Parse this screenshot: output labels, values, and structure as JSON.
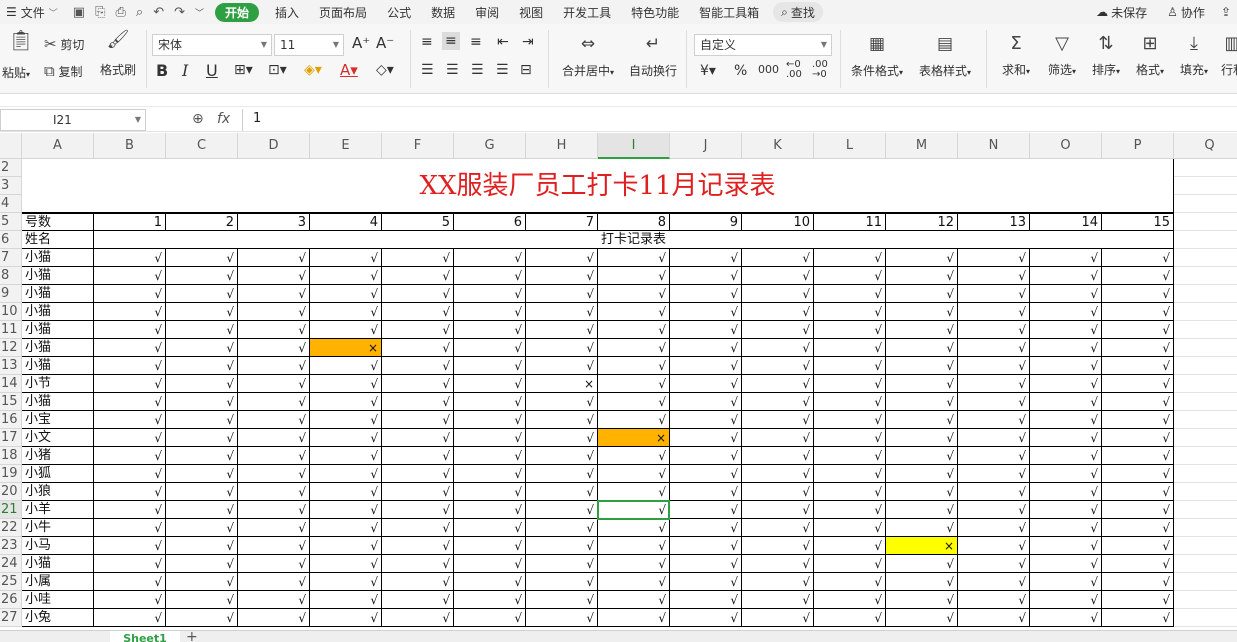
{
  "menu": {
    "file": "文件",
    "tabs": [
      "开始",
      "插入",
      "页面布局",
      "公式",
      "数据",
      "审阅",
      "视图",
      "开发工具",
      "特色功能",
      "智能工具箱"
    ],
    "search": "查找",
    "unsaved": "未保存",
    "collab": "协作"
  },
  "ribbon": {
    "paste": "粘贴",
    "cut": "剪切",
    "copy": "复制",
    "format_painter": "格式刷",
    "font_name": "宋体",
    "font_size": "11",
    "merge_center": "合并居中",
    "wrap_text": "自动换行",
    "number_format": "自定义",
    "cond_format": "条件格式",
    "table_style": "表格样式",
    "sum": "求和",
    "filter": "筛选",
    "sort": "排序",
    "format": "格式",
    "fill": "填充",
    "rowcol": "行和"
  },
  "formula_bar": {
    "name_box": "I21",
    "fx": "fx",
    "value": "1"
  },
  "sheet": {
    "columns": [
      "A",
      "B",
      "C",
      "D",
      "E",
      "F",
      "G",
      "H",
      "I",
      "J",
      "K",
      "L",
      "M",
      "N",
      "O",
      "P",
      "Q"
    ],
    "selected_col": "I",
    "selected_row": 21,
    "title": "XX服装厂员工打卡11月记录表",
    "header_label": "号数",
    "name_label": "姓名",
    "subheader": "打卡记录表",
    "days": [
      "1",
      "2",
      "3",
      "4",
      "5",
      "6",
      "7",
      "8",
      "9",
      "10",
      "11",
      "12",
      "13",
      "14",
      "15"
    ],
    "check": "√",
    "cross": "×",
    "names": [
      "小猫",
      "小猫",
      "小猫",
      "小猫",
      "小猫",
      "小猫",
      "小猫",
      "小节",
      "小猫",
      "小宝",
      "小文",
      "小猪",
      "小狐",
      "小狼",
      "小羊",
      "小牛",
      "小马",
      "小猫",
      "小属",
      "小哇",
      "小兔"
    ],
    "marks": [
      {
        "row": 12,
        "col": "E",
        "mark": "cross",
        "fill": "#ffb300"
      },
      {
        "row": 14,
        "col": "H",
        "mark": "cross",
        "fill": ""
      },
      {
        "row": 17,
        "col": "I",
        "mark": "cross",
        "fill": "#ffb300"
      },
      {
        "row": 23,
        "col": "M",
        "mark": "cross",
        "fill": "#ffff00"
      }
    ]
  },
  "tabs": {
    "sheet1": "Sheet1",
    "add": "+"
  }
}
